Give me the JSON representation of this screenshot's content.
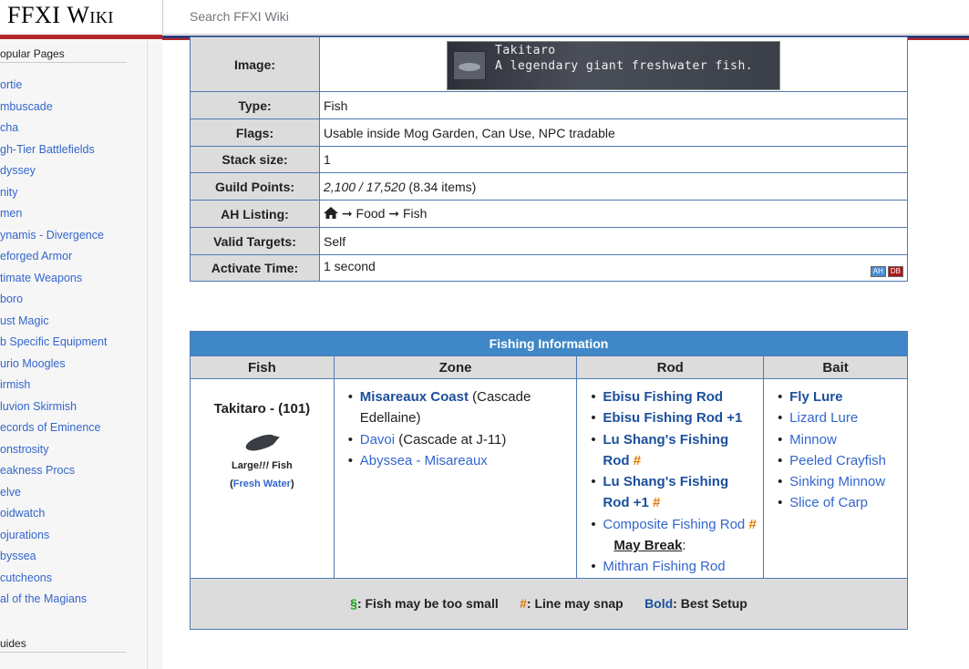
{
  "header": {
    "logo_text": "FFXI",
    "logo_text_sc": "Wiki",
    "search_placeholder": "Search FFXI Wiki"
  },
  "sidebar": {
    "popular_heading": "opular Pages",
    "items": [
      "ortie",
      "mbuscade",
      "cha",
      "gh-Tier Battlefields",
      "dyssey",
      "nity",
      "men",
      "ynamis - Divergence",
      "eforged Armor",
      "timate Weapons",
      "boro",
      "ust Magic",
      "b Specific Equipment",
      "urio Moogles",
      "irmish",
      "luvion Skirmish",
      "ecords of Eminence",
      "onstrosity",
      "eakness Procs",
      "elve",
      "oidwatch",
      "ojurations",
      "byssea",
      "cutcheons",
      "al of the Magians"
    ],
    "guides_heading": "uides"
  },
  "item": {
    "image_label": "Image:",
    "banner_line1": "Takitaro",
    "banner_line2": "A legendary giant freshwater fish.",
    "type_label": "Type:",
    "type_value": "Fish",
    "flags_label": "Flags:",
    "flags_value": "Usable inside Mog Garden, Can Use, NPC tradable",
    "stack_label": "Stack size:",
    "stack_value": "1",
    "guild_label": "Guild Points:",
    "guild_value": "2,100 / 17,520",
    "guild_extra": "(8.34 items)",
    "ah_label": "AH Listing:",
    "ah_food": "Food",
    "ah_fish": "Fish",
    "arrow": "➞",
    "valid_label": "Valid Targets:",
    "valid_value": "Self",
    "activate_label": "Activate Time:",
    "activate_value": "1 second",
    "badge_ah": "AH",
    "badge_db": "DB"
  },
  "fishing": {
    "caption": "Fishing Information",
    "col_fish": "Fish",
    "col_zone": "Zone",
    "col_rod": "Rod",
    "col_bait": "Bait",
    "fish_name": "Takitaro - (101)",
    "fish_size_prefix": "Large",
    "fish_size_bang": "!!!",
    "fish_size_suffix": "Fish",
    "water_open": "(",
    "water": "Fresh Water",
    "water_close": ")",
    "zones": {
      "z1_link": "Misareaux Coast",
      "z1_note": "(Cascade Edellaine)",
      "z2_link": "Davoi",
      "z2_note": "(Cascade at J-11)",
      "z3_link": "Abyssea - Misareaux"
    },
    "rods": {
      "r1": "Ebisu Fishing Rod",
      "r2": "Ebisu Fishing Rod +1",
      "r3": "Lu Shang's Fishing Rod",
      "r4": "Lu Shang's Fishing Rod +1",
      "r5": "Composite Fishing Rod",
      "may_break": "May Break",
      "may_break_colon": ":",
      "r6": "Mithran Fishing Rod",
      "hash": "#"
    },
    "baits": [
      "Fly Lure",
      "Lizard Lure",
      "Minnow",
      "Peeled Crayfish",
      "Sinking Minnow",
      "Slice of Carp"
    ],
    "legend": {
      "sect": "§",
      "sect_text": ": Fish may be too small",
      "hash": "#",
      "hash_text": ": Line may snap",
      "bold": "Bold",
      "bold_text": ": Best Setup"
    }
  }
}
